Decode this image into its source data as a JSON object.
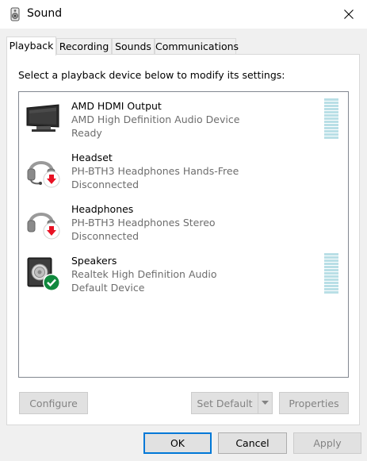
{
  "window": {
    "title": "Sound",
    "icon": "speaker-icon",
    "close_icon": "close-icon"
  },
  "tabs": [
    {
      "label": "Playback",
      "active": true
    },
    {
      "label": "Recording",
      "active": false
    },
    {
      "label": "Sounds",
      "active": false
    },
    {
      "label": "Communications",
      "active": false
    }
  ],
  "panel": {
    "instruction": "Select a playback device below to modify its settings:"
  },
  "devices": [
    {
      "name": "AMD HDMI Output",
      "description": "AMD High Definition Audio Device",
      "status": "Ready",
      "icon": "monitor-icon",
      "has_meter": true
    },
    {
      "name": "Headset",
      "description": "PH-BTH3 Headphones Hands-Free",
      "status": "Disconnected",
      "icon": "headset-icon",
      "badge": "red-down-arrow-icon",
      "has_meter": false
    },
    {
      "name": "Headphones",
      "description": "PH-BTH3 Headphones Stereo",
      "status": "Disconnected",
      "icon": "headphones-icon",
      "badge": "red-down-arrow-icon",
      "has_meter": false
    },
    {
      "name": "Speakers",
      "description": "Realtek High Definition Audio",
      "status": "Default Device",
      "icon": "speaker-box-icon",
      "badge": "green-check-icon",
      "has_meter": true
    }
  ],
  "panel_buttons": {
    "configure": "Configure",
    "set_default": "Set Default",
    "properties": "Properties"
  },
  "dialog_buttons": {
    "ok": "OK",
    "cancel": "Cancel",
    "apply": "Apply"
  },
  "colors": {
    "accent": "#0078d7",
    "disabled_text": "#838383",
    "secondary_text": "#6d6d6d",
    "meter": "#b9dfe6",
    "badge_red": "#e81123",
    "badge_green": "#10893e"
  }
}
